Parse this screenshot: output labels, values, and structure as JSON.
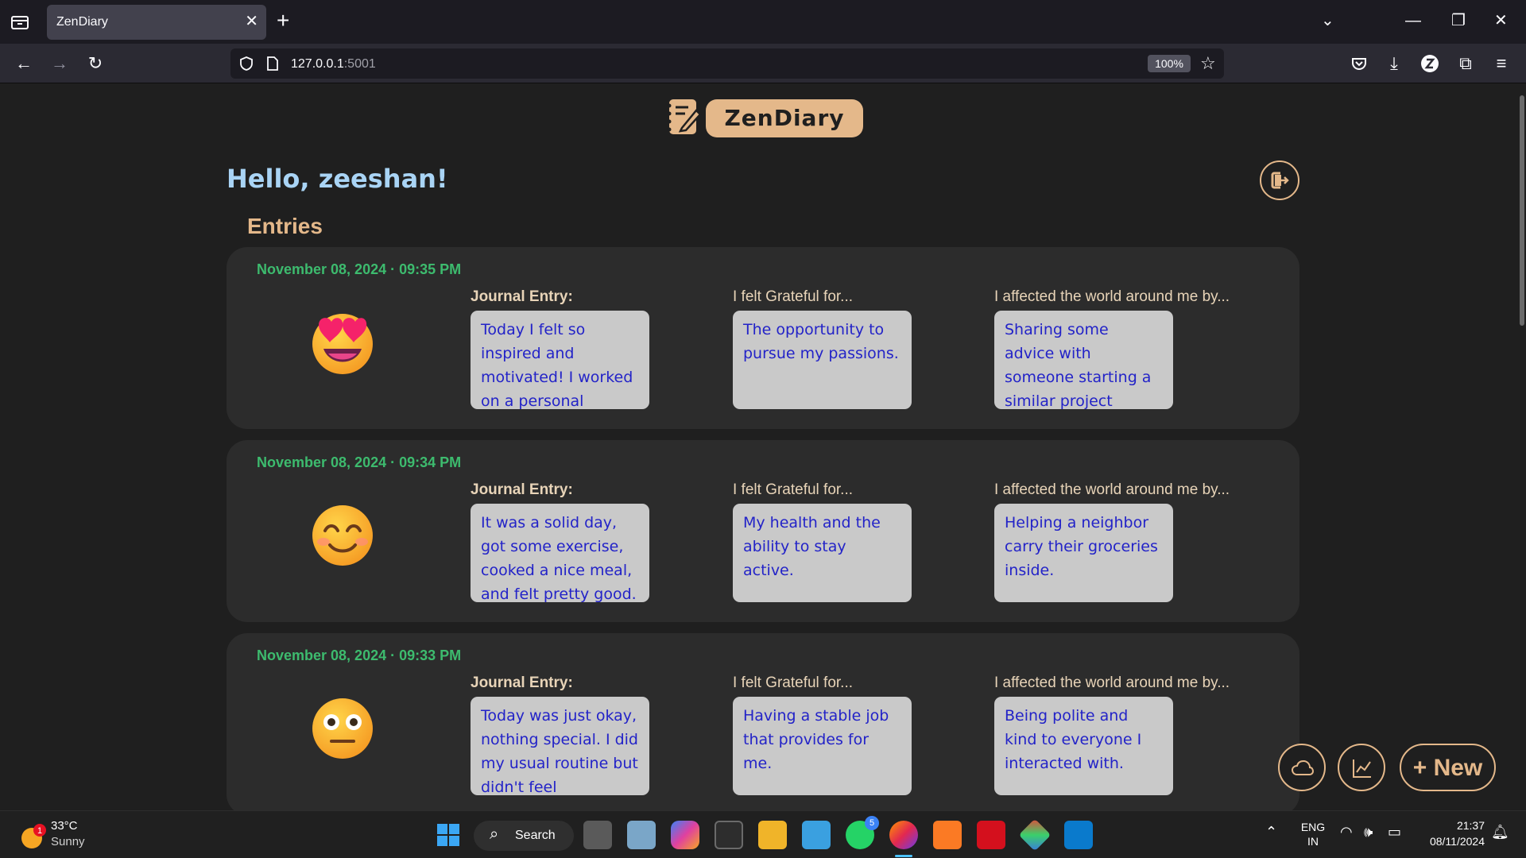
{
  "browser": {
    "tab_title": "ZenDiary",
    "url_host": "127.0.0.1",
    "url_port": ":5001",
    "zoom": "100%"
  },
  "app": {
    "logo_text": "ZenDiary",
    "greeting": "Hello, zeeshan!",
    "section_title": "Entries",
    "new_button_label": "+ New"
  },
  "entries": [
    {
      "date": "November 08, 2024 · 09:35 PM",
      "mood": "heart-eyes",
      "journal_label": "Journal Entry:",
      "grateful_label": "I felt Grateful for...",
      "affected_label": "I affected the world around me by...",
      "journal": "Today I felt so inspired and motivated! I worked on a personal project and made amazing",
      "grateful": "The opportunity to pursue my passions.",
      "affected": "Sharing some advice with someone starting a similar project"
    },
    {
      "date": "November 08, 2024 · 09:34 PM",
      "mood": "smiling",
      "journal_label": "Journal Entry:",
      "grateful_label": "I felt Grateful for...",
      "affected_label": "I affected the world around me by...",
      "journal": "It was a solid day, got some exercise, cooked a nice meal, and felt pretty good.",
      "grateful": "My health and the ability to stay active.",
      "affected": "Helping a neighbor carry their groceries inside."
    },
    {
      "date": "November 08, 2024 · 09:33 PM",
      "mood": "neutral",
      "journal_label": "Journal Entry:",
      "grateful_label": "I felt Grateful for...",
      "affected_label": "I affected the world around me by...",
      "journal": "Today was just okay, nothing special. I did my usual routine but didn't feel particularly",
      "grateful": "Having a stable job that provides for me.",
      "affected": "Being polite and kind to everyone I interacted with."
    }
  ],
  "taskbar": {
    "weather_temp": "33°C",
    "weather_condition": "Sunny",
    "weather_badge": "1",
    "search_label": "Search",
    "whatsapp_badge": "5",
    "lang_line1": "ENG",
    "lang_line2": "IN",
    "time": "21:37",
    "date": "08/11/2024"
  },
  "colors": {
    "accent": "#e4b88a",
    "date_green": "#3dbb6e",
    "greeting_blue": "#a9d4f5",
    "note_bg": "#c9c9c9",
    "note_text": "#2323c8",
    "card_bg": "#2c2c2c"
  }
}
